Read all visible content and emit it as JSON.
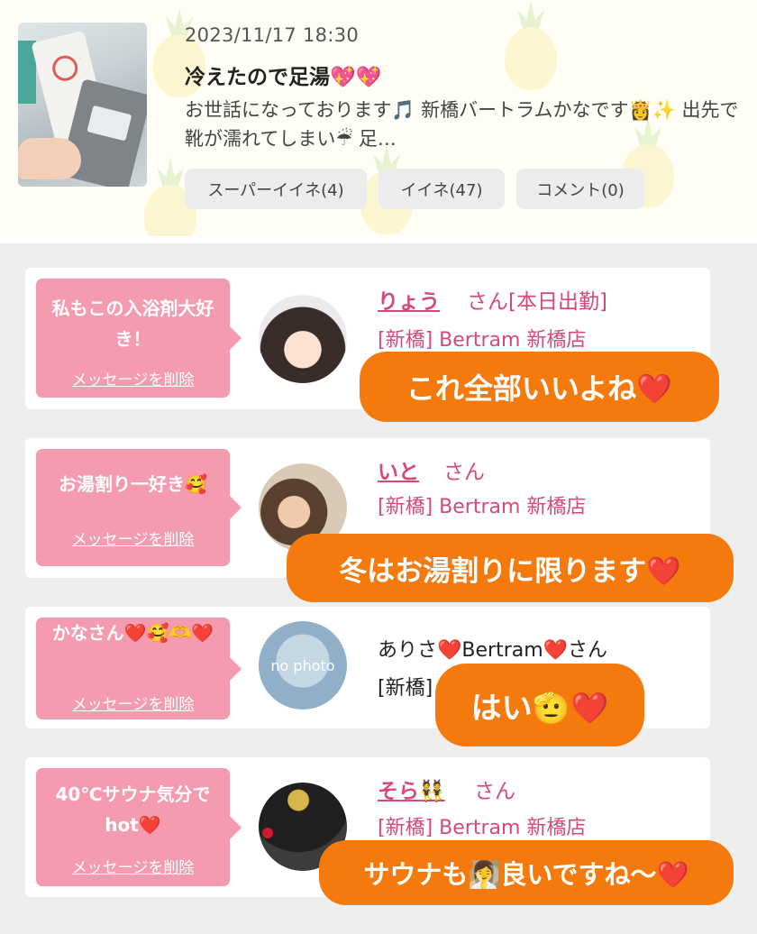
{
  "post": {
    "date": "2023/11/17 18:30",
    "title": "冷えたので足湯💖💖",
    "excerpt": "お世話になっております🎵 新橋バートラムかなです👸✨ 出先で靴が濡れてしまい☔ 足…",
    "buttons": {
      "super_iine": "スーパーイイネ(4)",
      "iine": "イイネ(47)",
      "comment": "コメント(0)"
    }
  },
  "messages": [
    {
      "message": "私もこの入浴剤大好き！",
      "delete_label": "メッセージを削除",
      "user": "りょう",
      "suffix": "さん[本日出勤]",
      "shop": "[新橋] Bertram 新橋店",
      "overlay_reply": "これ全部いいよね❤️"
    },
    {
      "message": "お湯割り一好き🥰",
      "delete_label": "メッセージを削除",
      "user": "いと",
      "suffix": "さん",
      "shop": "[新橋] Bertram 新橋店",
      "overlay_reply": "冬はお湯割りに限ります❤️"
    },
    {
      "message": "かなさん❤️🥰🫶❤️",
      "delete_label": "メッセージを削除",
      "user": "ありさ❤️Bertram❤️さん",
      "shop": "[新橋]",
      "avatar_text": "no photo",
      "overlay_reply": "はい🫡❤️"
    },
    {
      "message": "40℃サウナ気分でhot❤️",
      "delete_label": "メッセージを削除",
      "user": "そら👯",
      "suffix": "さん",
      "shop": "[新橋] Bertram 新橋店",
      "overlay_reply": "サウナも🧖‍♀️良いですね〜❤️"
    }
  ]
}
